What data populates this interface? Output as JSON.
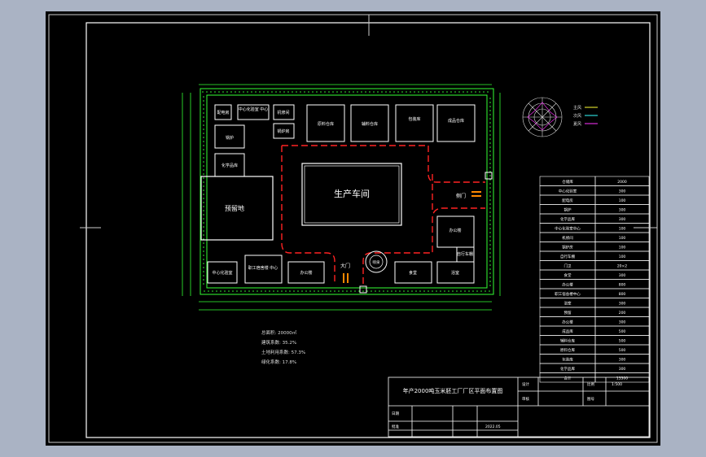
{
  "drawing": {
    "center_building": "生产车间",
    "pool": "预留地",
    "main_gate": "大门",
    "side_gate": "侧门",
    "title": "年产2000吨玉米胚工厂厂区平面布置图",
    "date": "2022.05",
    "rooms": {
      "r_tl1": "配电房",
      "r_tl2": "中心化验室 中心",
      "r_tl3": "机修间",
      "r_tl4": "锅炉房",
      "r_tl5": "锅炉",
      "r_l_mid": "化学品库",
      "r_top1": "原料仓库",
      "r_top2": "辅料仓库",
      "r_top3": "包装库",
      "r_top4": "成品仓库",
      "r_right1": "办公楼",
      "r_right2": "自行车棚",
      "r_b1": "中心化验室",
      "r_b2": "职工宿舍楼 中心",
      "r_b3": "办公楼",
      "r_b4": "食堂",
      "r_b5": "浴室",
      "fountain": "喷泉"
    },
    "legend": [
      "主风",
      "次风",
      "夏风"
    ],
    "stats": [
      "总面积: 20000㎡",
      "建筑系数: 35.2%",
      "土地利用系数: 57.3%",
      "绿化系数: 17.8%"
    ],
    "table_rows": [
      [
        "仓储库",
        "2000"
      ],
      [
        "中心化验室",
        "300"
      ],
      [
        "配电房",
        "100"
      ],
      [
        "锅炉",
        "300"
      ],
      [
        "化学品库",
        "300"
      ],
      [
        "中心化验室中心",
        "100"
      ],
      [
        "机修间",
        "100"
      ],
      [
        "锅炉房",
        "100"
      ],
      [
        "自行车棚",
        "100"
      ],
      [
        "门卫",
        "20×2"
      ],
      [
        "食堂",
        "300"
      ],
      [
        "办公楼",
        "800"
      ],
      [
        "职工宿舍楼中心",
        "800"
      ],
      [
        "浴室",
        "300"
      ],
      [
        "预留",
        "200"
      ],
      [
        "办公楼",
        "300"
      ],
      [
        "成品库",
        "500"
      ],
      [
        "辅料仓库",
        "500"
      ],
      [
        "原料仓库",
        "500"
      ],
      [
        "包装库",
        "300"
      ],
      [
        "化学品库",
        "300"
      ],
      [
        "合计",
        "13300"
      ]
    ],
    "title_block": {
      "labels": [
        "设计",
        "审核",
        "比例",
        "图号",
        "日期",
        "批准"
      ],
      "values": [
        "",
        "",
        "1:500",
        "",
        "2022.05",
        ""
      ]
    }
  }
}
